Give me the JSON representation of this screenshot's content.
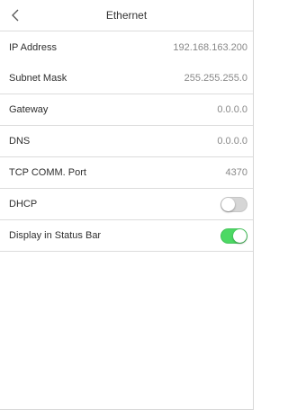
{
  "header": {
    "title": "Ethernet",
    "back_icon": "chevron-left-icon"
  },
  "settings": [
    {
      "label": "IP Address",
      "value": "192.168.163.200"
    },
    {
      "label": "Subnet Mask",
      "value": "255.255.255.0"
    },
    {
      "label": "Gateway",
      "value": "0.0.0.0"
    },
    {
      "label": "DNS",
      "value": "0.0.0.0"
    },
    {
      "label": "TCP COMM. Port",
      "value": "4370"
    }
  ],
  "toggles": [
    {
      "label": "DHCP",
      "state": "off"
    },
    {
      "label": "Display in Status Bar",
      "state": "on"
    }
  ],
  "colors": {
    "toggle_on": "#4cd964",
    "toggle_off": "#d6d6d6",
    "divider": "#dcdcdc"
  }
}
